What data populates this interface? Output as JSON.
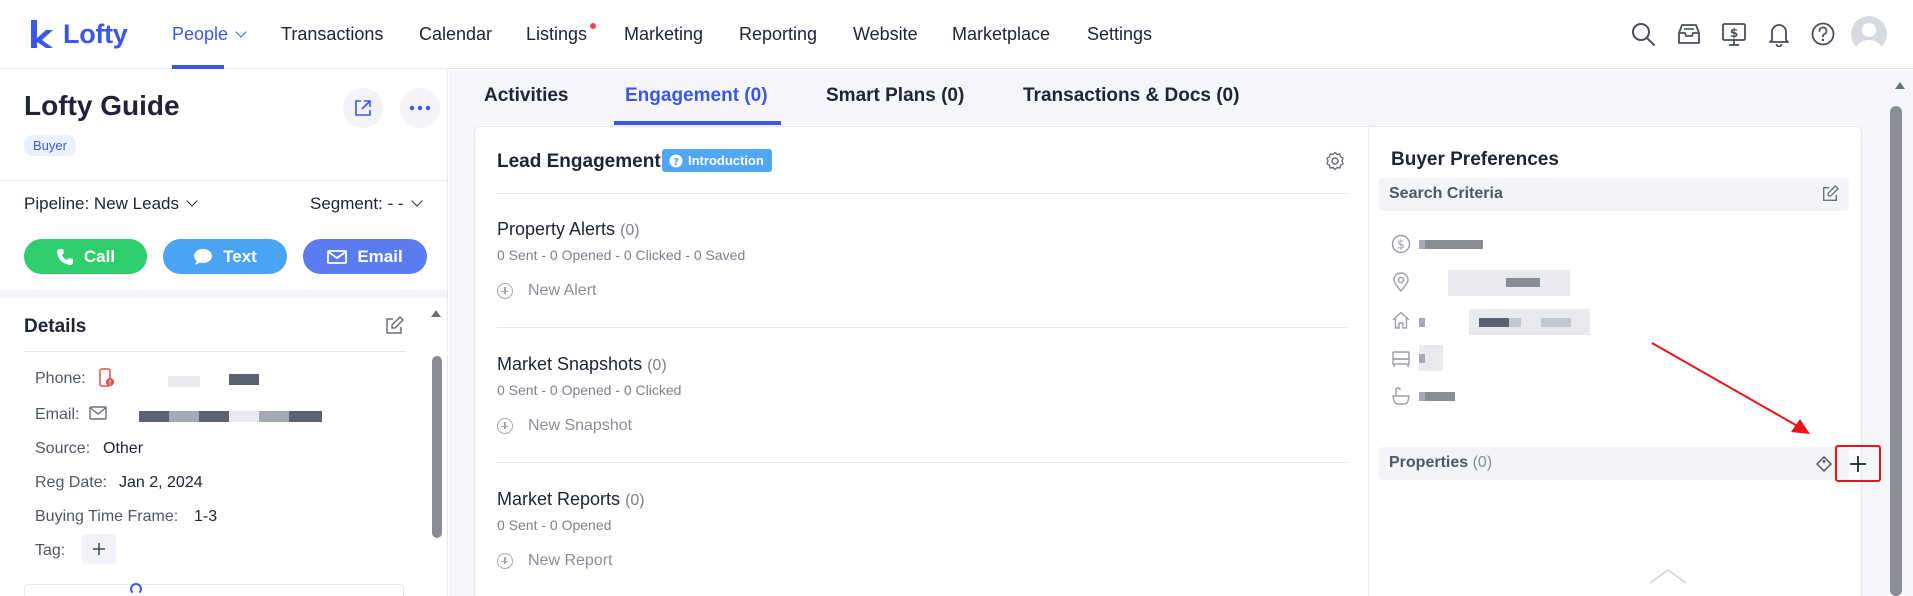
{
  "app": {
    "logo_text": "Lofty",
    "brand_color": "#3a57e8"
  },
  "nav": {
    "items": [
      {
        "label": "People",
        "active": true
      },
      {
        "label": "Transactions"
      },
      {
        "label": "Calendar"
      },
      {
        "label": "Listings",
        "has_dot": true
      },
      {
        "label": "Marketing"
      },
      {
        "label": "Reporting"
      },
      {
        "label": "Website"
      },
      {
        "label": "Marketplace"
      },
      {
        "label": "Settings"
      }
    ],
    "icons": [
      "search-icon",
      "inbox-icon",
      "dollar-monitor-icon",
      "bell-icon",
      "help-icon",
      "avatar"
    ]
  },
  "contact": {
    "name": "Lofty Guide",
    "tag": "Buyer",
    "pipeline": "Pipeline: New Leads",
    "segment": "Segment: - -",
    "actions": {
      "call": "Call",
      "text": "Text",
      "email": "Email"
    }
  },
  "details": {
    "title": "Details",
    "fields": {
      "phone_label": "Phone:",
      "email_label": "Email:",
      "source_label": "Source:",
      "source_value": "Other",
      "reg_date_label": "Reg Date:",
      "reg_date_value": "Jan 2, 2024",
      "buying_time_label": "Buying Time Frame:",
      "buying_time_value": "1-3",
      "tag_label": "Tag:"
    }
  },
  "tabs": [
    {
      "label": "Activities"
    },
    {
      "label": "Engagement (0)",
      "active": true
    },
    {
      "label": "Smart Plans (0)"
    },
    {
      "label": "Transactions & Docs (0)"
    }
  ],
  "lead_engagement": {
    "title": "Lead Engagement",
    "badge": "Introduction",
    "sections": [
      {
        "title": "Property Alerts",
        "count": "(0)",
        "stats": "0 Sent - 0 Opened - 0 Clicked - 0 Saved",
        "action": "New Alert"
      },
      {
        "title": "Market Snapshots",
        "count": "(0)",
        "stats": "0 Sent - 0 Opened - 0 Clicked",
        "action": "New Snapshot"
      },
      {
        "title": "Market Reports",
        "count": "(0)",
        "stats": "0 Sent - 0 Opened",
        "action": "New Report"
      }
    ]
  },
  "buyer_preferences": {
    "title": "Buyer Preferences",
    "search_criteria": "Search Criteria",
    "properties_label": "Properties",
    "properties_count": "(0)"
  },
  "colors": {
    "call": "#2fce6c",
    "text": "#4aa3f5",
    "email": "#5b7cf0",
    "highlight": "#e8141b"
  }
}
